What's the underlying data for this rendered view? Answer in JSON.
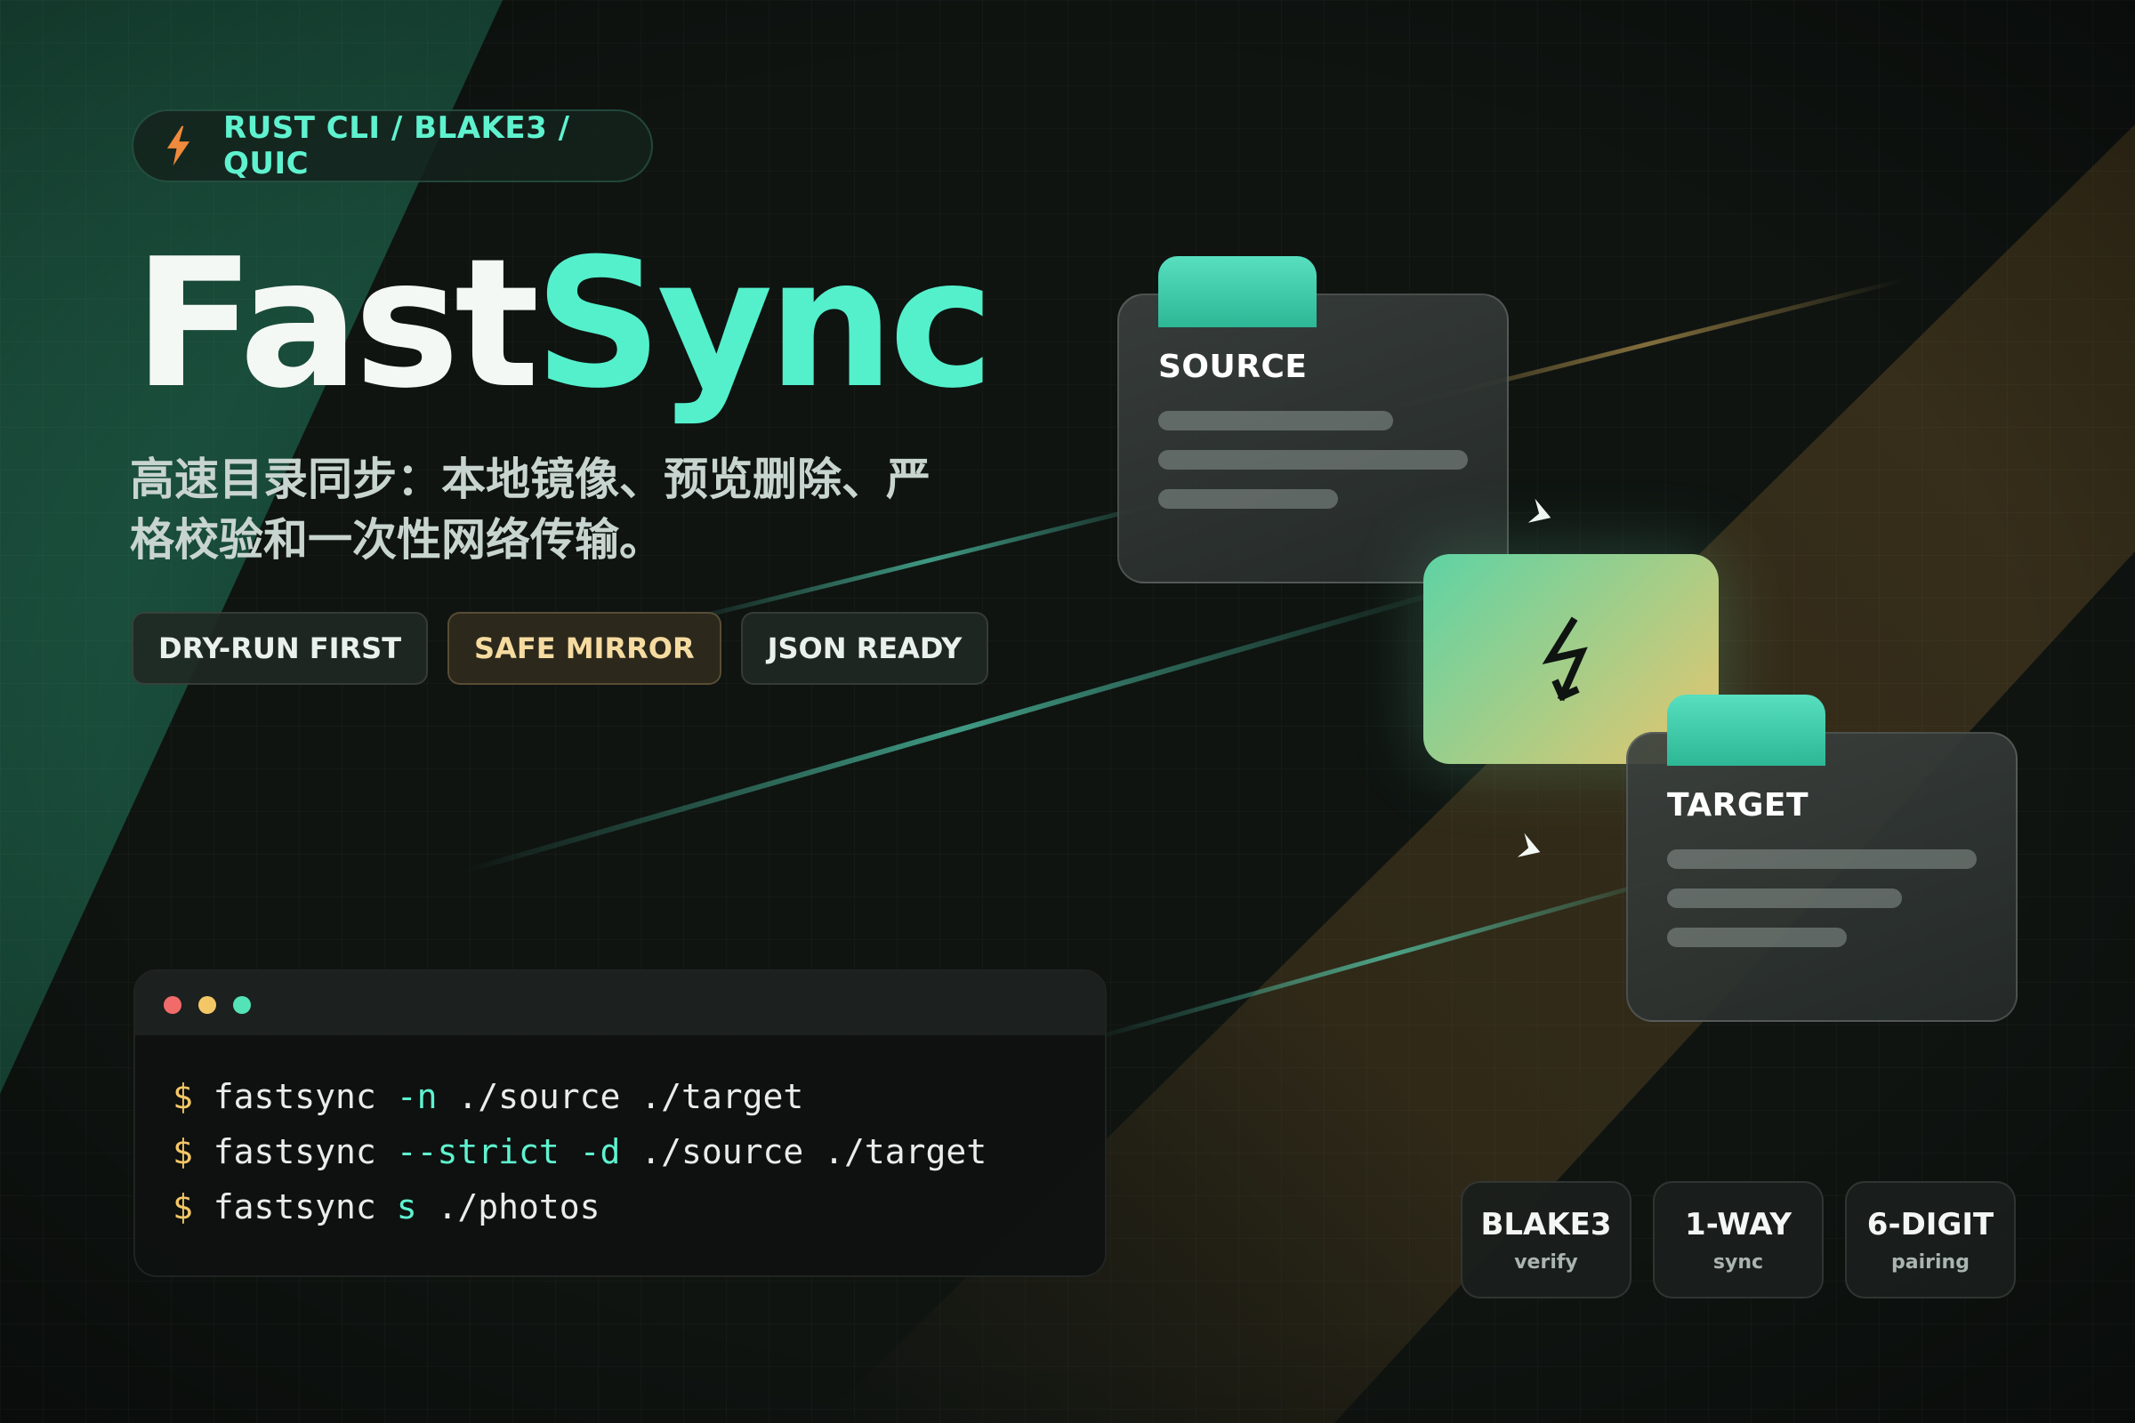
{
  "top_badge": {
    "text": "RUST CLI / BLAKE3 / QUIC",
    "icon": "lightning-bolt-icon"
  },
  "title": {
    "part1": "Fast",
    "part2": "Sync"
  },
  "subtitle": {
    "line1": "高速目录同步：本地镜像、预览删除、严",
    "line2": "格校验和一次性网络传输。"
  },
  "tags": [
    {
      "label": "DRY-RUN FIRST"
    },
    {
      "label": "SAFE MIRROR"
    },
    {
      "label": "JSON READY"
    }
  ],
  "terminal": {
    "prompt": "$",
    "lines": [
      {
        "cmd": "fastsync",
        "flag": "-n",
        "args": "./source ./target"
      },
      {
        "cmd": "fastsync",
        "flag": "--strict -d",
        "args": "./source ./target"
      },
      {
        "cmd": "fastsync",
        "flag": "s",
        "args": "./photos"
      }
    ]
  },
  "diagram": {
    "source_label": "SOURCE",
    "target_label": "TARGET",
    "sync_icon": "sync-bolt-icon"
  },
  "stats": [
    {
      "value": "BLAKE3",
      "caption": "verify"
    },
    {
      "value": "1-WAY",
      "caption": "sync"
    },
    {
      "value": "6-DIGIT",
      "caption": "pairing"
    }
  ],
  "colors": {
    "accent_mint": "#54f0cc",
    "accent_amber": "#f4c766",
    "background": "#0f1411"
  }
}
